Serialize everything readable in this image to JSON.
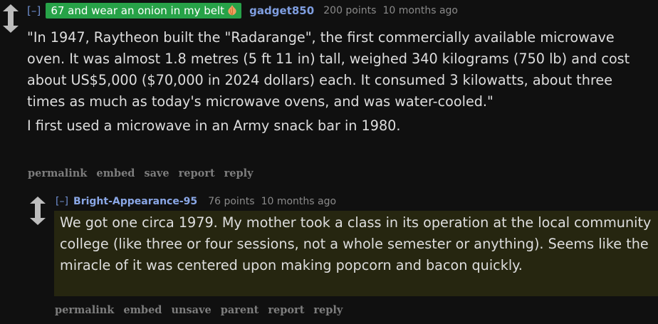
{
  "comment1": {
    "expand_label": "[–]",
    "flair_text": "67 and wear an onion in my belt",
    "flair_icon": "onion-icon",
    "author": "gadget850",
    "points": "200 points",
    "age": "10 months ago",
    "paragraphs": [
      "\"In 1947, Raytheon built the \"Radarange\", the first commercially available microwave oven. It was almost 1.8 metres (5 ft 11 in) tall, weighed 340 kilograms (750 lb) and cost about US$5,000 ($70,000 in 2024 dollars) each. It consumed 3 kilowatts, about three times as much as today's microwave ovens, and was water-cooled.\"",
      "I first used a microwave in an Army snack bar in 1980."
    ],
    "buttons": {
      "permalink": "permalink",
      "embed": "embed",
      "save": "save",
      "report": "report",
      "reply": "reply"
    }
  },
  "comment2": {
    "expand_label": "[–]",
    "author": "Bright-Appearance-95",
    "points": "76 points",
    "age": "10 months ago",
    "body": "We got one circa 1979. My mother took a class in its operation at the local community college (like three or four sessions, not a whole semester or anything). Seems like the miracle of it was centered upon making popcorn and bacon quickly.",
    "buttons": {
      "permalink": "permalink",
      "embed": "embed",
      "unsave": "unsave",
      "parent": "parent",
      "report": "report",
      "reply": "reply"
    }
  },
  "colors": {
    "background": "#101010",
    "flair_background": "#27a248",
    "author": "#7f9ee0",
    "highlight_background": "#262610",
    "button_text": "#7d7d7d"
  }
}
